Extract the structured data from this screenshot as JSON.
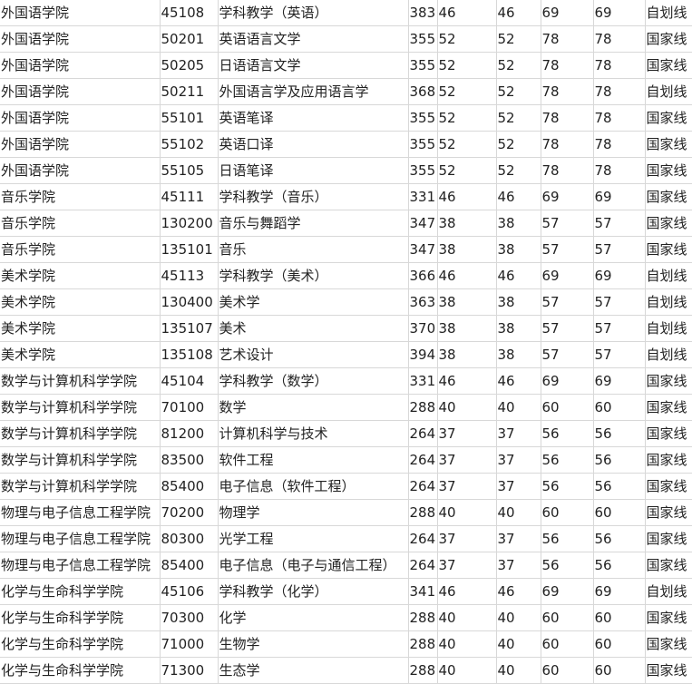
{
  "rows": [
    [
      "外国语学院",
      "45108",
      "学科教学（英语）",
      "383",
      "46",
      "46",
      "69",
      "69",
      "自划线"
    ],
    [
      "外国语学院",
      "50201",
      "英语语言文学",
      "355",
      "52",
      "52",
      "78",
      "78",
      "国家线"
    ],
    [
      "外国语学院",
      "50205",
      "日语语言文学",
      "355",
      "52",
      "52",
      "78",
      "78",
      "国家线"
    ],
    [
      "外国语学院",
      "50211",
      "外国语言学及应用语言学",
      "368",
      "52",
      "52",
      "78",
      "78",
      "自划线"
    ],
    [
      "外国语学院",
      "55101",
      "英语笔译",
      "355",
      "52",
      "52",
      "78",
      "78",
      "国家线"
    ],
    [
      "外国语学院",
      "55102",
      "英语口译",
      "355",
      "52",
      "52",
      "78",
      "78",
      "国家线"
    ],
    [
      "外国语学院",
      "55105",
      "日语笔译",
      "355",
      "52",
      "52",
      "78",
      "78",
      "国家线"
    ],
    [
      "音乐学院",
      "45111",
      "学科教学（音乐）",
      "331",
      "46",
      "46",
      "69",
      "69",
      "国家线"
    ],
    [
      "音乐学院",
      "130200",
      "音乐与舞蹈学",
      "347",
      "38",
      "38",
      "57",
      "57",
      "国家线"
    ],
    [
      "音乐学院",
      "135101",
      "音乐",
      "347",
      "38",
      "38",
      "57",
      "57",
      "国家线"
    ],
    [
      "美术学院",
      "45113",
      "学科教学（美术）",
      "366",
      "46",
      "46",
      "69",
      "69",
      "自划线"
    ],
    [
      "美术学院",
      "130400",
      "美术学",
      "363",
      "38",
      "38",
      "57",
      "57",
      "自划线"
    ],
    [
      "美术学院",
      "135107",
      "美术",
      "370",
      "38",
      "38",
      "57",
      "57",
      "自划线"
    ],
    [
      "美术学院",
      "135108",
      "艺术设计",
      "394",
      "38",
      "38",
      "57",
      "57",
      "自划线"
    ],
    [
      "数学与计算机科学学院",
      "45104",
      "学科教学（数学）",
      "331",
      "46",
      "46",
      "69",
      "69",
      "国家线"
    ],
    [
      "数学与计算机科学学院",
      "70100",
      "数学",
      "288",
      "40",
      "40",
      "60",
      "60",
      "国家线"
    ],
    [
      "数学与计算机科学学院",
      "81200",
      "计算机科学与技术",
      "264",
      "37",
      "37",
      "56",
      "56",
      "国家线"
    ],
    [
      "数学与计算机科学学院",
      "83500",
      "软件工程",
      "264",
      "37",
      "37",
      "56",
      "56",
      "国家线"
    ],
    [
      "数学与计算机科学学院",
      "85400",
      "电子信息（软件工程）",
      "264",
      "37",
      "37",
      "56",
      "56",
      "国家线"
    ],
    [
      "物理与电子信息工程学院",
      "70200",
      "物理学",
      "288",
      "40",
      "40",
      "60",
      "60",
      "国家线"
    ],
    [
      "物理与电子信息工程学院",
      "80300",
      "光学工程",
      "264",
      "37",
      "37",
      "56",
      "56",
      "国家线"
    ],
    [
      "物理与电子信息工程学院",
      "85400",
      "电子信息（电子与通信工程）",
      "264",
      "37",
      "37",
      "56",
      "56",
      "国家线"
    ],
    [
      "化学与生命科学学院",
      "45106",
      "学科教学（化学）",
      "341",
      "46",
      "46",
      "69",
      "69",
      "自划线"
    ],
    [
      "化学与生命科学学院",
      "70300",
      "化学",
      "288",
      "40",
      "40",
      "60",
      "60",
      "国家线"
    ],
    [
      "化学与生命科学学院",
      "71000",
      "生物学",
      "288",
      "40",
      "40",
      "60",
      "60",
      "国家线"
    ],
    [
      "化学与生命科学学院",
      "71300",
      "生态学",
      "288",
      "40",
      "40",
      "60",
      "60",
      "国家线"
    ]
  ]
}
